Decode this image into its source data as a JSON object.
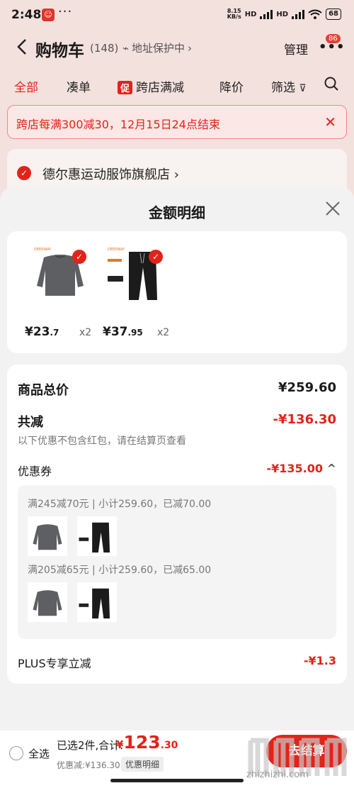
{
  "status_bar": {
    "time": "2:48",
    "more": "···",
    "speed_top": "8.15",
    "speed_bottom": "KB/s",
    "net1": "HD",
    "net2": "HD",
    "battery": "68"
  },
  "header": {
    "title": "购物车",
    "count": "(148)",
    "address": "地址保护中",
    "manage": "管理",
    "badge": "86"
  },
  "tabs": [
    {
      "label": "全部",
      "active": true
    },
    {
      "label": "凑单"
    },
    {
      "label": "跨店满减",
      "tag": "促"
    },
    {
      "label": "降价"
    },
    {
      "label": "筛选"
    }
  ],
  "banner": {
    "text": "跨店每满300减30，12月15日24点结束"
  },
  "store": {
    "name": "德尔惠运动服饰旗舰店"
  },
  "sheet": {
    "title": "金额明细",
    "products": [
      {
        "price_main": "¥23",
        "price_dec": ".7",
        "qty": "x2",
        "kind": "sweater"
      },
      {
        "price_main": "¥37",
        "price_dec": ".95",
        "qty": "x2",
        "kind": "pants"
      }
    ],
    "total_label": "商品总价",
    "total_value": "¥259.60",
    "discount_label": "共减",
    "discount_value": "-¥136.30",
    "discount_note": "以下优惠不包含红包，请在结算页查看",
    "coupon_label": "优惠券",
    "coupon_value": "-¥135.00",
    "coupon_rules": [
      "满245减70元 | 小计259.60，已减70.00",
      "满205减65元 | 小计259.60，已减65.00"
    ],
    "plus_label": "PLUS专享立减",
    "plus_value": "-¥1.3"
  },
  "bottom_bar": {
    "select_all": "全选",
    "selected": "已选2件,合计:",
    "total_yen": "¥",
    "total_big": "123",
    "total_dec": ".30",
    "saved": "优惠减:¥136.30",
    "detail": "优惠明细",
    "checkout": "去结算"
  },
  "watermark": {
    "url": "zhizhizhi.com"
  },
  "colors": {
    "accent": "#e2231a",
    "sheet_bg": "#f2f2f2",
    "page_bg": "#f3e1de"
  }
}
